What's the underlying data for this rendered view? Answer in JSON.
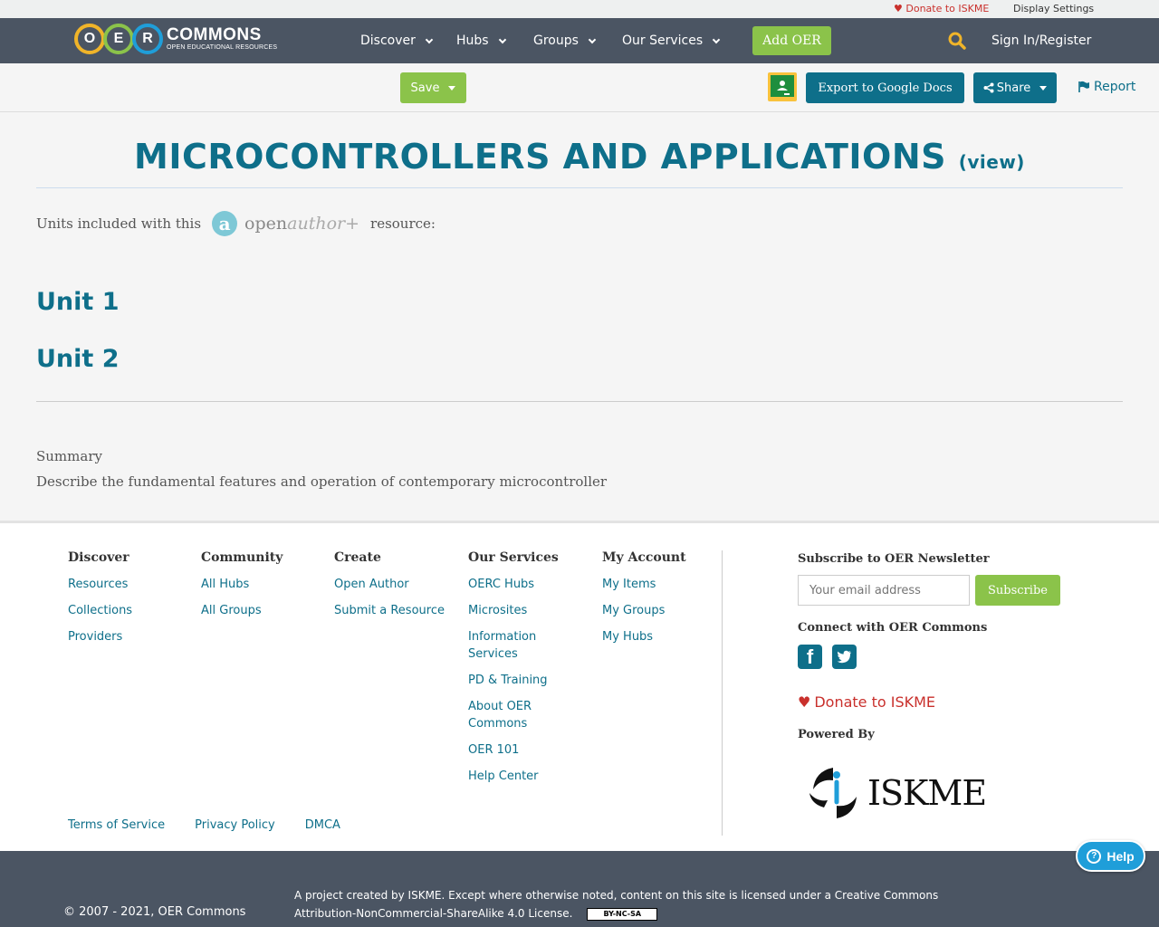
{
  "utility": {
    "donate": "Donate to ISKME",
    "display_settings": "Display Settings"
  },
  "logo": {
    "letters": [
      "O",
      "E",
      "R"
    ],
    "name": "COMMONS",
    "tagline": "OPEN EDUCATIONAL RESOURCES"
  },
  "nav": {
    "items": [
      {
        "label": "Discover"
      },
      {
        "label": "Hubs"
      },
      {
        "label": "Groups"
      },
      {
        "label": "Our Services"
      }
    ],
    "add_oer": "Add OER",
    "sign_in": "Sign In/Register"
  },
  "toolbar": {
    "save": "Save",
    "export": "Export to Google Docs",
    "share": "Share",
    "report": "Report"
  },
  "content": {
    "title": "MICROCONTROLLERS AND APPLICATIONS",
    "view_link": "(view)",
    "units_prefix": "Units included with this",
    "units_suffix": "resource:",
    "openauthor_logo": {
      "mark": "a",
      "open": "open",
      "author": "author+"
    },
    "units": [
      "Unit 1",
      "Unit 2"
    ],
    "summary_label": "Summary",
    "summary_text": "Describe the fundamental features and operation of contemporary microcontroller"
  },
  "footer": {
    "columns": [
      {
        "title": "Discover",
        "links": [
          "Resources",
          "Collections",
          "Providers"
        ]
      },
      {
        "title": "Community",
        "links": [
          "All Hubs",
          "All Groups"
        ]
      },
      {
        "title": "Create",
        "links": [
          "Open Author",
          "Submit a Resource"
        ]
      },
      {
        "title": "Our Services",
        "links": [
          "OERC Hubs",
          "Microsites",
          "Information Services",
          "PD & Training",
          "About OER Commons",
          "OER 101",
          "Help Center"
        ]
      },
      {
        "title": "My Account",
        "links": [
          "My Items",
          "My Groups",
          "My Hubs"
        ]
      }
    ],
    "newsletter_title": "Subscribe to OER Newsletter",
    "email_placeholder": "Your email address",
    "subscribe": "Subscribe",
    "connect_title": "Connect with OER Commons",
    "donate": "Donate to ISKME",
    "powered_by": "Powered By",
    "iskme_logo_text": "ISKME",
    "legal": [
      "Terms of Service",
      "Privacy Policy",
      "DMCA"
    ]
  },
  "bottom": {
    "copyright": "© 2007 - 2021, OER Commons",
    "license": "A project created by ISKME. Except where otherwise noted, content on this site is licensed under a Creative Commons Attribution-NonCommercial-ShareAlike 4.0 License.",
    "cc_badge": "BY-NC-SA"
  },
  "help": "Help",
  "colors": {
    "brand_teal": "#0e6f8a",
    "green": "#8bc34a",
    "nav_gray": "#4b5563",
    "donate_red": "#c9302c",
    "search_yellow": "#f0b429"
  }
}
